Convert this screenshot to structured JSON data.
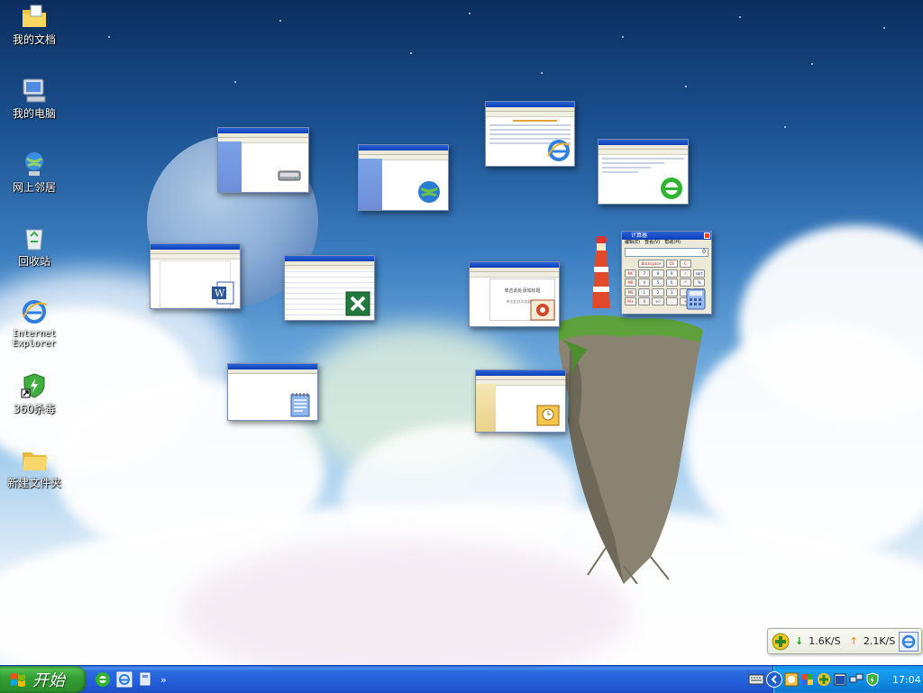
{
  "desktop": {
    "icons": [
      {
        "label": "我的文档",
        "icon": "my-documents-folder-icon"
      },
      {
        "label": "我的电脑",
        "icon": "my-computer-icon"
      },
      {
        "label": "网上邻居",
        "icon": "network-places-icon"
      },
      {
        "label": "回收站",
        "icon": "recycle-bin-icon"
      },
      {
        "label": "Internet Explorer",
        "icon": "internet-explorer-icon"
      },
      {
        "label": "360杀毒",
        "icon": "360-antivirus-shortcut-icon"
      },
      {
        "label": "新建文件夹",
        "icon": "new-folder-icon"
      }
    ],
    "windows": [
      {
        "app": "windows-explorer",
        "icon": "drive-icon"
      },
      {
        "app": "network-connections",
        "icon": "network-globe-icon"
      },
      {
        "app": "internet-explorer-hao123",
        "icon": "internet-explorer-icon"
      },
      {
        "app": "internet-explorer-green",
        "icon": "internet-explorer-green-icon"
      },
      {
        "app": "calculator",
        "icon": "calculator-icon",
        "title": "计算器",
        "menu": [
          "编辑(E)",
          "查看(V)",
          "帮助(H)"
        ],
        "display": "0",
        "keys": [
          "Backspace",
          "CE",
          "C",
          "MC",
          "7",
          "8",
          "9",
          "/",
          "sqrt",
          "MR",
          "4",
          "5",
          "6",
          "*",
          "%",
          "MS",
          "1",
          "2",
          "3",
          "-",
          "1/x",
          "M+",
          "0",
          "+/-",
          ".",
          "+",
          "="
        ]
      },
      {
        "app": "microsoft-word",
        "icon": "word-icon"
      },
      {
        "app": "microsoft-excel",
        "icon": "excel-icon"
      },
      {
        "app": "microsoft-powerpoint",
        "icon": "powerpoint-icon",
        "slide_title": "单击此处添加标题",
        "slide_subtitle": "单击此处添加副标题"
      },
      {
        "app": "notepad",
        "icon": "notepad-icon"
      },
      {
        "app": "microsoft-access",
        "icon": "access-icon"
      }
    ]
  },
  "netspeed": {
    "down_arrow": "↓",
    "down": "1.6K/S",
    "up_arrow": "↑",
    "up": "2.1K/S"
  },
  "taskbar": {
    "start_label": "开始",
    "quicklaunch_more": "»",
    "clock": "17:04"
  },
  "colors": {
    "taskbar": "#245edb",
    "start_button": "#35a235",
    "tray": "#0f8ae0"
  }
}
